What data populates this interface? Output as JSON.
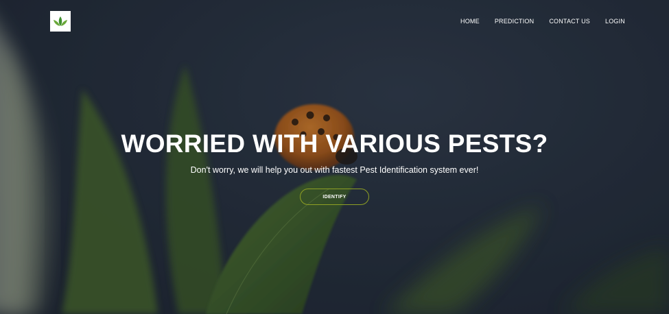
{
  "brand": {
    "logo_icon": "leaf-sprout-icon",
    "logo_color": "#3f8f2e"
  },
  "nav": {
    "items": [
      {
        "label": "HOME"
      },
      {
        "label": "PREDICTION"
      },
      {
        "label": "CONTACT US"
      },
      {
        "label": "LOGIN"
      }
    ]
  },
  "hero": {
    "headline": "WORRIED WITH VARIOUS PESTS?",
    "subheadline": "Don't worry, we will help you out with fastest Pest Identification system ever!",
    "cta_label": "IDENTIFY",
    "cta_border_color": "#8fa024",
    "background_image": "ladybug-on-leaf"
  }
}
